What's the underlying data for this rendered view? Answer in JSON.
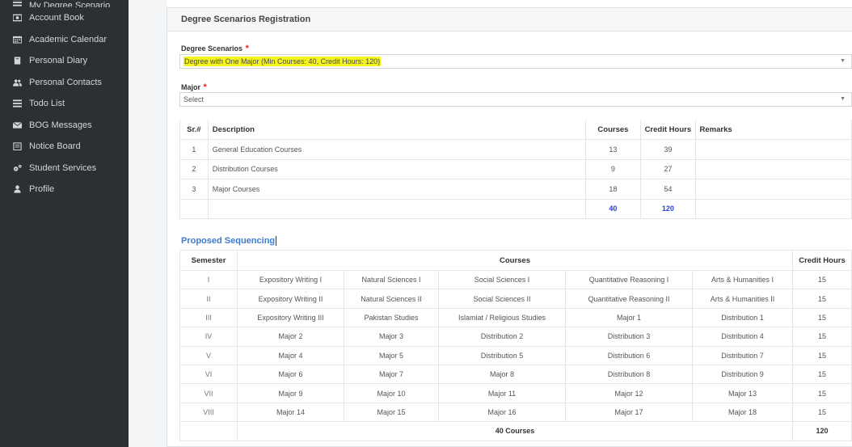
{
  "sidebar": {
    "items": [
      {
        "label": "My Degree Scenario",
        "icon": "list-icon"
      },
      {
        "label": "Account Book",
        "icon": "money-icon"
      },
      {
        "label": "Academic Calendar",
        "icon": "calendar-icon"
      },
      {
        "label": "Personal Diary",
        "icon": "book-icon"
      },
      {
        "label": "Personal Contacts",
        "icon": "users-icon"
      },
      {
        "label": "Todo List",
        "icon": "list-icon"
      },
      {
        "label": "BOG Messages",
        "icon": "envelope-icon"
      },
      {
        "label": "Notice Board",
        "icon": "clipboard-icon"
      },
      {
        "label": "Student Services",
        "icon": "cogs-icon"
      },
      {
        "label": "Profile",
        "icon": "user-icon"
      }
    ]
  },
  "panel": {
    "title": "Degree Scenarios Registration",
    "degree_label": "Degree Scenarios",
    "degree_value": "Degree with One Major (Min Courses: 40, Credit Hours: 120)",
    "major_label": "Major",
    "major_value": "Select",
    "required_mark": "*"
  },
  "summary_table": {
    "headers": {
      "sr": "Sr.#",
      "description": "Description",
      "courses": "Courses",
      "credit_hours": "Credit Hours",
      "remarks": "Remarks"
    },
    "rows": [
      {
        "sr": "1",
        "description": "General Education Courses",
        "courses": "13",
        "credit_hours": "39",
        "remarks": ""
      },
      {
        "sr": "2",
        "description": "Distribution Courses",
        "courses": "9",
        "credit_hours": "27",
        "remarks": ""
      },
      {
        "sr": "3",
        "description": "Major Courses",
        "courses": "18",
        "credit_hours": "54",
        "remarks": ""
      }
    ],
    "total": {
      "courses": "40",
      "credit_hours": "120"
    }
  },
  "sequencing": {
    "title": "Proposed Sequencing",
    "headers": {
      "semester": "Semester",
      "courses": "Courses",
      "credit_hours": "Credit Hours"
    },
    "rows": [
      {
        "semester": "I",
        "courses": [
          "Expository Writing I",
          "Natural Sciences I",
          "Social Sciences I",
          "Quantitative Reasoning I",
          "Arts & Humanities I"
        ],
        "credit_hours": "15"
      },
      {
        "semester": "II",
        "courses": [
          "Expository Writing II",
          "Natural Sciences II",
          "Social Sciences II",
          "Quantitative Reasoning II",
          "Arts & Humanities II"
        ],
        "credit_hours": "15"
      },
      {
        "semester": "III",
        "courses": [
          "Expository Writing III",
          "Pakistan Studies",
          "Islamiat / Religious Studies",
          "Major 1",
          "Distribution 1"
        ],
        "credit_hours": "15"
      },
      {
        "semester": "IV",
        "courses": [
          "Major 2",
          "Major 3",
          "Distribution 2",
          "Distribution 3",
          "Distribution 4"
        ],
        "credit_hours": "15"
      },
      {
        "semester": "V",
        "courses": [
          "Major 4",
          "Major 5",
          "Distribution 5",
          "Distribution 6",
          "Distribution 7"
        ],
        "credit_hours": "15"
      },
      {
        "semester": "VI",
        "courses": [
          "Major 6",
          "Major 7",
          "Major 8",
          "Distribution 8",
          "Distribution 9"
        ],
        "credit_hours": "15"
      },
      {
        "semester": "VII",
        "courses": [
          "Major 9",
          "Major 10",
          "Major 11",
          "Major 12",
          "Major 13"
        ],
        "credit_hours": "15"
      },
      {
        "semester": "VIII",
        "courses": [
          "Major 14",
          "Major 15",
          "Major 16",
          "Major 17",
          "Major 18"
        ],
        "credit_hours": "15"
      }
    ],
    "footer": {
      "courses": "40 Courses",
      "credit_hours": "120"
    }
  },
  "colors": {
    "sidebar_bg": "#2b3034",
    "highlight": "#f4f31d",
    "accent_blue": "#3c7bd0",
    "total_blue": "#2a3fd6",
    "required_red": "#e02424"
  }
}
